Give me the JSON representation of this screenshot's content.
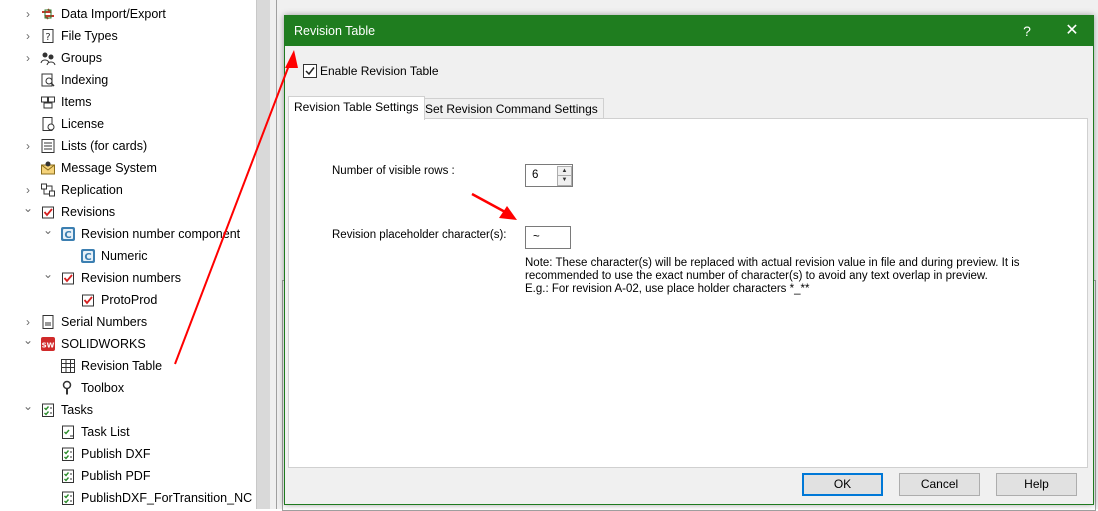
{
  "tree": {
    "items": [
      {
        "label": "Data Import/Export",
        "chevron": "right",
        "icon": "import-export-icon"
      },
      {
        "label": "File Types",
        "chevron": "right",
        "icon": "question-file-icon"
      },
      {
        "label": "Groups",
        "chevron": "right",
        "icon": "groups-icon"
      },
      {
        "label": "Indexing",
        "chevron": "",
        "icon": "indexing-icon"
      },
      {
        "label": "Items",
        "chevron": "",
        "icon": "items-icon"
      },
      {
        "label": "License",
        "chevron": "",
        "icon": "license-icon"
      },
      {
        "label": "Lists (for cards)",
        "chevron": "right",
        "icon": "list-icon"
      },
      {
        "label": "Message System",
        "chevron": "",
        "icon": "message-icon"
      },
      {
        "label": "Replication",
        "chevron": "right",
        "icon": "replication-icon"
      },
      {
        "label": "Revisions",
        "chevron": "down",
        "icon": "revision-icon"
      },
      {
        "label": "Revision number component",
        "chevron": "down",
        "icon": "component-icon"
      },
      {
        "label": "Numeric",
        "chevron": "",
        "icon": "component-icon"
      },
      {
        "label": "Revision numbers",
        "chevron": "down",
        "icon": "revision-icon"
      },
      {
        "label": "ProtoProd",
        "chevron": "",
        "icon": "revision-icon"
      },
      {
        "label": "Serial Numbers",
        "chevron": "right",
        "icon": "serial-icon"
      },
      {
        "label": "SOLIDWORKS",
        "chevron": "down",
        "icon": "solidworks-icon"
      },
      {
        "label": "Revision Table",
        "chevron": "",
        "icon": "table-icon"
      },
      {
        "label": "Toolbox",
        "chevron": "",
        "icon": "toolbox-icon"
      },
      {
        "label": "Tasks",
        "chevron": "down",
        "icon": "tasks-icon"
      },
      {
        "label": "Task List",
        "chevron": "",
        "icon": "task-list-icon"
      },
      {
        "label": "Publish DXF",
        "chevron": "",
        "icon": "tasks-icon"
      },
      {
        "label": "Publish PDF",
        "chevron": "",
        "icon": "tasks-icon"
      },
      {
        "label": "PublishDXF_ForTransition_NC",
        "chevron": "",
        "icon": "tasks-icon"
      }
    ]
  },
  "dialog": {
    "title": "Revision Table",
    "help_glyph": "?",
    "close_glyph": "✕",
    "enable_label": "Enable Revision Table",
    "enable_checked": true,
    "tabs": [
      {
        "label": "Revision Table Settings",
        "active": true
      },
      {
        "label": "Set Revision Command Settings",
        "active": false
      }
    ],
    "rows_label": "Number of visible rows :",
    "rows_value": "6",
    "placeholder_label": "Revision placeholder character(s):",
    "placeholder_value": "~",
    "note_line1": "Note: These character(s) will be replaced with actual revision value in file and during preview. It is",
    "note_line2": "recommended to use the exact number of character(s) to avoid any text overlap in preview.",
    "note_line3": "E.g.: For revision A-02, use place holder characters *_**",
    "ok_label": "OK",
    "cancel_label": "Cancel",
    "help_label": "Help"
  },
  "colors": {
    "titlebar": "#1f7d1f",
    "arrow": "#ff0000",
    "ok_border": "#0078d7"
  }
}
